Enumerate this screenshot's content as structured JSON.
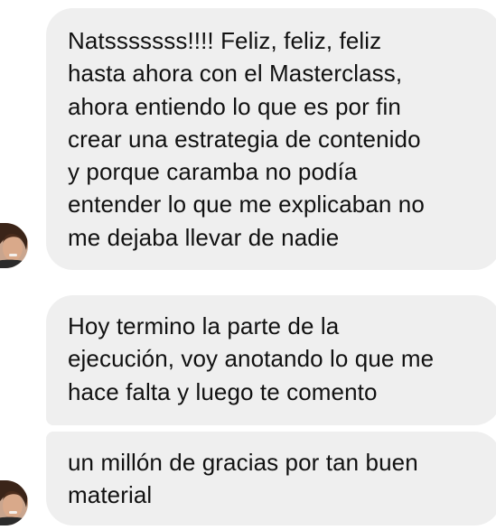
{
  "conversation": {
    "messages": [
      {
        "text": "Natsssssss!!!! Feliz, feliz, feliz\nhasta ahora con el Masterclass,\nahora entiendo lo que es por fin\ncrear una estrategia de contenido\ny porque caramba no podía\nentender lo que me explicaban no\nme dejaba llevar de nadie"
      },
      {
        "text": "Hoy termino la parte de la\nejecución, voy anotando lo que me\nhace falta y luego te comento"
      },
      {
        "text": "un millón de gracias por tan buen\nmaterial"
      }
    ],
    "colors": {
      "bubble_background": "#efefef",
      "text": "#111111",
      "page_background": "#ffffff"
    },
    "avatar_icon": "profile-photo-avatar"
  }
}
